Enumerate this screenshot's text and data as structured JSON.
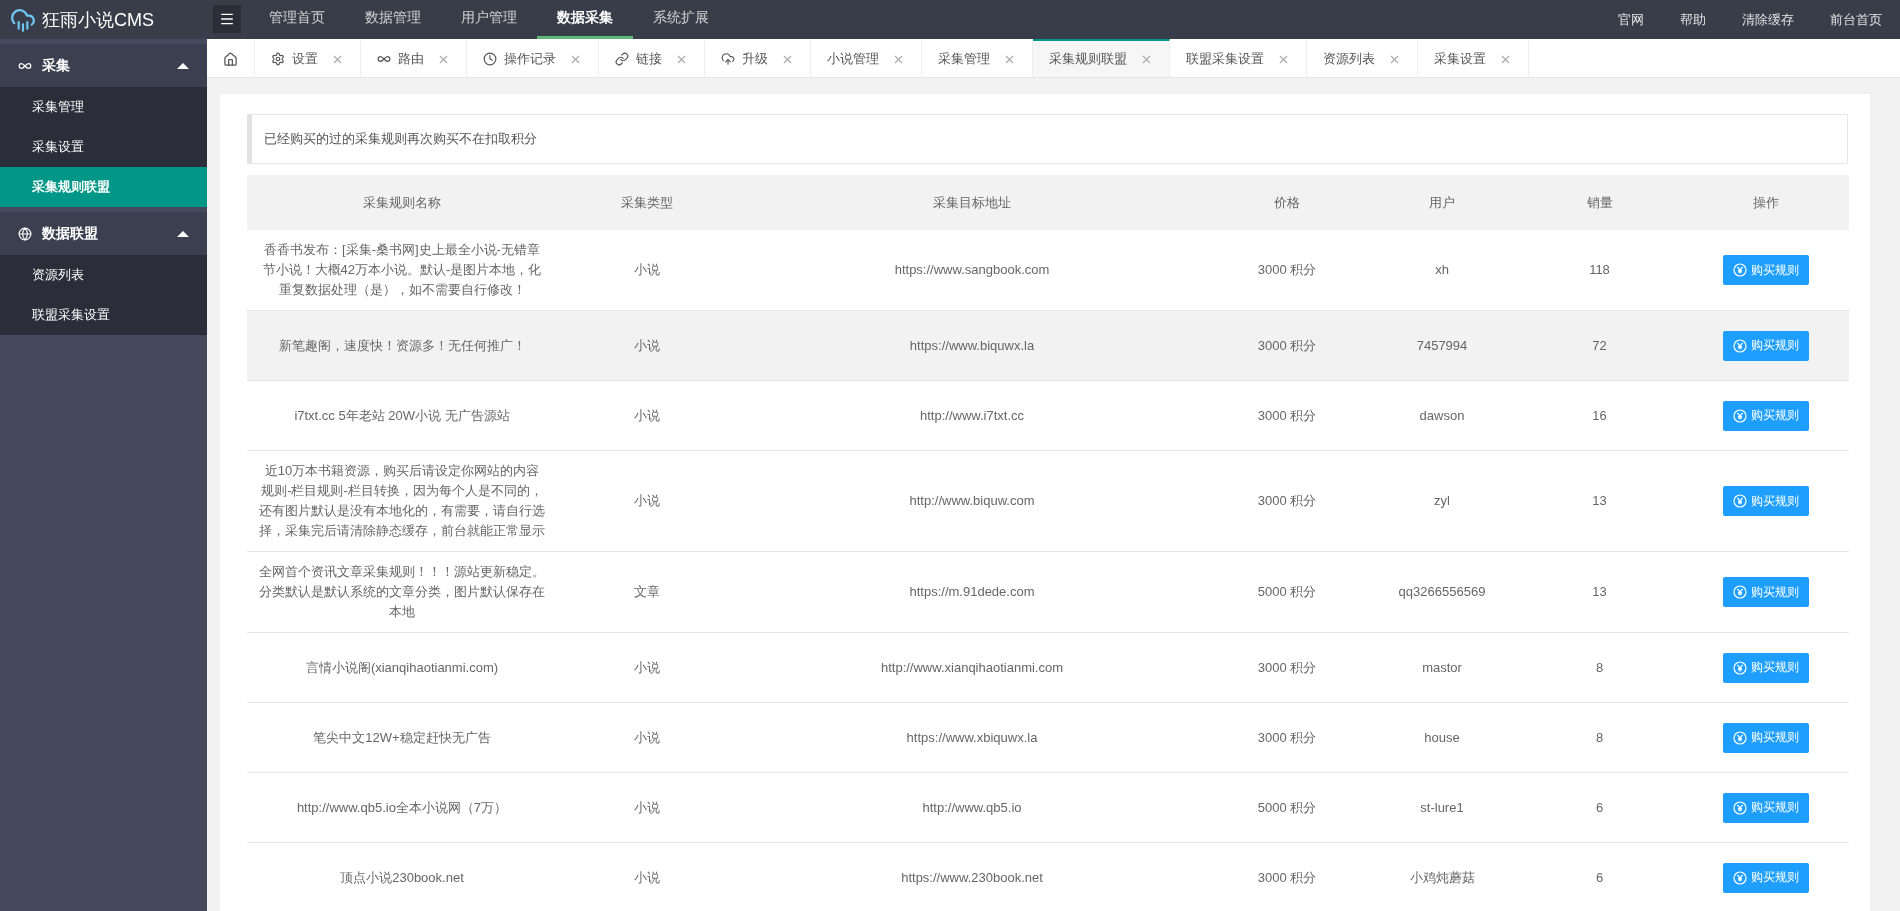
{
  "app": {
    "logo_text": "狂雨小说CMS"
  },
  "top_nav": [
    {
      "label": "管理首页",
      "selected": false
    },
    {
      "label": "数据管理",
      "selected": false
    },
    {
      "label": "用户管理",
      "selected": false
    },
    {
      "label": "数据采集",
      "selected": true
    },
    {
      "label": "系统扩展",
      "selected": false
    }
  ],
  "top_links": [
    "官网",
    "帮助",
    "清除缓存",
    "前台首页"
  ],
  "sidebar": {
    "groups": [
      {
        "kind": "infinity",
        "label": "采集",
        "expanded": true,
        "items": [
          {
            "label": "采集管理",
            "selected": false
          },
          {
            "label": "采集设置",
            "selected": false
          },
          {
            "label": "采集规则联盟",
            "selected": true
          }
        ]
      },
      {
        "kind": "globe",
        "label": "数据联盟",
        "expanded": true,
        "items": [
          {
            "label": "资源列表",
            "selected": false
          },
          {
            "label": "联盟采集设置",
            "selected": false
          }
        ]
      }
    ]
  },
  "tabs": [
    {
      "kind": "home",
      "selected": false
    },
    {
      "kind": "settings",
      "label": "设置",
      "selected": false
    },
    {
      "kind": "route",
      "label": "路由",
      "selected": false
    },
    {
      "kind": "history",
      "label": "操作记录",
      "selected": false
    },
    {
      "kind": "link",
      "label": "链接",
      "selected": false
    },
    {
      "kind": "upgrade",
      "label": "升级",
      "selected": false
    },
    {
      "kind": "plain",
      "label": "小说管理",
      "selected": false
    },
    {
      "kind": "plain",
      "label": "采集管理",
      "selected": false
    },
    {
      "kind": "plain",
      "label": "采集规则联盟",
      "selected": true
    },
    {
      "kind": "plain",
      "label": "联盟采集设置",
      "selected": false
    },
    {
      "kind": "plain",
      "label": "资源列表",
      "selected": false
    },
    {
      "kind": "plain",
      "label": "采集设置",
      "selected": false
    }
  ],
  "notice": "已经购买的过的采集规则再次购买不在扣取积分",
  "table": {
    "columns": [
      "采集规则名称",
      "采集类型",
      "采集目标地址",
      "价格",
      "用户",
      "销量",
      "操作"
    ],
    "rows": [
      {
        "name": "香香书发布：[采集-桑书网]史上最全小说-无错章节小说！大概42万本小说。默认-是图片本地，化重复数据处理（是），如不需要自行修改！",
        "type": "小说",
        "url": "https://www.sangbook.com",
        "price": "3000 积分",
        "user": "xh",
        "sales": "118",
        "action": "购买规则",
        "selected": false
      },
      {
        "name": "新笔趣阁，速度快！资源多！无任何推广！",
        "type": "小说",
        "url": "https://www.biquwx.la",
        "price": "3000 积分",
        "user": "7457994",
        "sales": "72",
        "action": "购买规则",
        "selected": true
      },
      {
        "name": "i7txt.cc 5年老站 20W小说 无广告源站",
        "type": "小说",
        "url": "http://www.i7txt.cc",
        "price": "3000 积分",
        "user": "dawson",
        "sales": "16",
        "action": "购买规则",
        "selected": false
      },
      {
        "name": "近10万本书籍资源，购买后请设定你网站的内容规则-栏目规则-栏目转换，因为每个人是不同的，还有图片默认是没有本地化的，有需要，请自行选择，采集完后请清除静态缓存，前台就能正常显示",
        "type": "小说",
        "url": "http://www.biquw.com",
        "price": "3000 积分",
        "user": "zyl",
        "sales": "13",
        "action": "购买规则",
        "selected": false
      },
      {
        "name": "全网首个资讯文章采集规则！！！源站更新稳定。分类默认是默认系统的文章分类，图片默认保存在本地",
        "type": "文章",
        "url": "https://m.91dede.com",
        "price": "5000 积分",
        "user": "qq3266556569",
        "sales": "13",
        "action": "购买规则",
        "selected": false
      },
      {
        "name": "言情小说阁(xianqihaotianmi.com)",
        "type": "小说",
        "url": "http://www.xianqihaotianmi.com",
        "price": "3000 积分",
        "user": "mastor",
        "sales": "8",
        "action": "购买规则",
        "selected": false
      },
      {
        "name": "笔尖中文12W+稳定赶快无广告",
        "type": "小说",
        "url": "https://www.xbiquwx.la",
        "price": "3000 积分",
        "user": "house",
        "sales": "8",
        "action": "购买规则",
        "selected": false
      },
      {
        "name": "http://www.qb5.io全本小说网（7万）",
        "type": "小说",
        "url": "http://www.qb5.io",
        "price": "5000 积分",
        "user": "st-lure1",
        "sales": "6",
        "action": "购买规则",
        "selected": false
      },
      {
        "name": "顶点小说230book.net",
        "type": "小说",
        "url": "https://www.230book.net",
        "price": "3000 积分",
        "user": "小鸡炖蘑菇",
        "sales": "6",
        "action": "购买规则",
        "selected": false
      }
    ]
  }
}
